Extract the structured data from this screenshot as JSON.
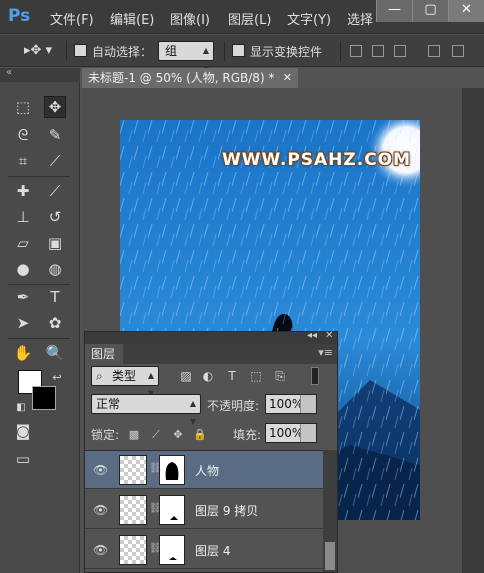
{
  "app": {
    "logo": "Ps"
  },
  "menu": [
    "文件(F)",
    "编辑(E)",
    "图像(I)",
    "图层(L)",
    "文字(Y)",
    "选择"
  ],
  "window_buttons": [
    "—",
    "▢",
    "✕"
  ],
  "options_bar": {
    "auto_select_label": "自动选择：",
    "auto_select_value": "组",
    "show_transform_label": "显示变换控件"
  },
  "document": {
    "tab_title": "未标题-1 @ 50% (人物, RGB/8) *",
    "watermark": "WWW.PSAHZ.COM"
  },
  "layers_panel": {
    "tab_label": "图层",
    "filter_kind": "类型",
    "blend_mode": "正常",
    "opacity_label": "不透明度:",
    "opacity_value": "100%",
    "lock_label": "锁定:",
    "fill_label": "填充:",
    "fill_value": "100%",
    "layers": [
      {
        "name": "人物",
        "selected": true
      },
      {
        "name": "图层 9 拷贝",
        "selected": false
      },
      {
        "name": "图层 4",
        "selected": false
      }
    ]
  },
  "colors": {
    "foreground": "#ffffff",
    "background": "#000000",
    "layer_selected": "#596c83",
    "canvas_sky": "#1f6fc0"
  },
  "icons": {
    "tools": [
      "marquee-icon",
      "move-icon",
      "lasso-icon",
      "quick-select-icon",
      "crop-icon",
      "eyedropper-icon",
      "healing-icon",
      "brush-icon",
      "stamp-icon",
      "history-brush-icon",
      "eraser-icon",
      "gradient-icon",
      "blur-icon",
      "dodge-icon",
      "pen-icon",
      "type-icon",
      "path-select-icon",
      "shape-icon",
      "hand-icon",
      "zoom-icon"
    ]
  }
}
